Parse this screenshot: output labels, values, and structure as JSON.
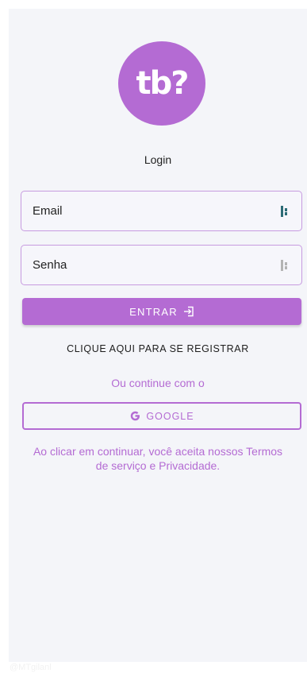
{
  "logo": {
    "text": "tb?"
  },
  "title": "Login",
  "email": {
    "placeholder": "Email",
    "value": ""
  },
  "password": {
    "placeholder": "Senha",
    "value": ""
  },
  "login_button": {
    "label": "ENTRAR"
  },
  "register_link": "CLIQUE AQUI PARA SE REGISTRAR",
  "continue_text": "Ou continue com o",
  "google_button": {
    "label": "GOOGLE"
  },
  "terms": "Ao clicar em continuar, você aceita nossos Termos de serviço e Privacidade.",
  "watermark": "@MTgilanl",
  "colors": {
    "primary": "#b46bd3",
    "background": "#f4f5f9",
    "email_icon": "#2c6b76",
    "password_icon": "#b3b3b3"
  },
  "icons": {
    "email_field": "password-manager-icon",
    "password_field": "password-manager-icon",
    "login": "login-arrow-icon",
    "google": "google-g-icon"
  }
}
